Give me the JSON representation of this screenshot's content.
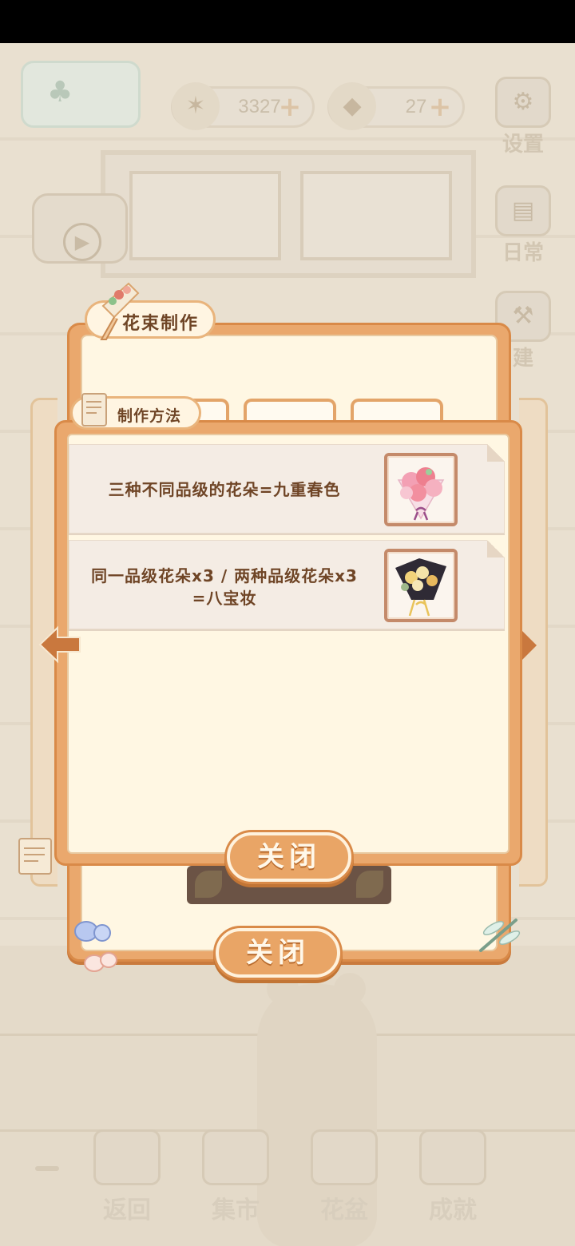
{
  "hud": {
    "fish_count": "3327",
    "cheese_count": "27",
    "settings_label": "设置",
    "daily_label": "日常",
    "build_label": "建"
  },
  "back_panel": {
    "title": "花束制作",
    "close_label": "关闭"
  },
  "front_panel": {
    "title": "制作方法",
    "close_label": "关闭",
    "recipes": [
      {
        "text": "三种不同品级的花朵=九重春色",
        "image": "pink-bouquet-image"
      },
      {
        "text_line1": "同一品级花朵x3 / 两种品级花朵x3",
        "text_line2": "=八宝妆",
        "image": "dark-bouquet-image"
      }
    ]
  },
  "bottom_nav": {
    "items": [
      "返回",
      "集市",
      "花盆",
      "成就"
    ]
  },
  "colors": {
    "panel_orange": "#eaa86d",
    "panel_cream": "#fff7e3",
    "text_brown": "#6f4526",
    "button_orange": "#e9a566"
  }
}
